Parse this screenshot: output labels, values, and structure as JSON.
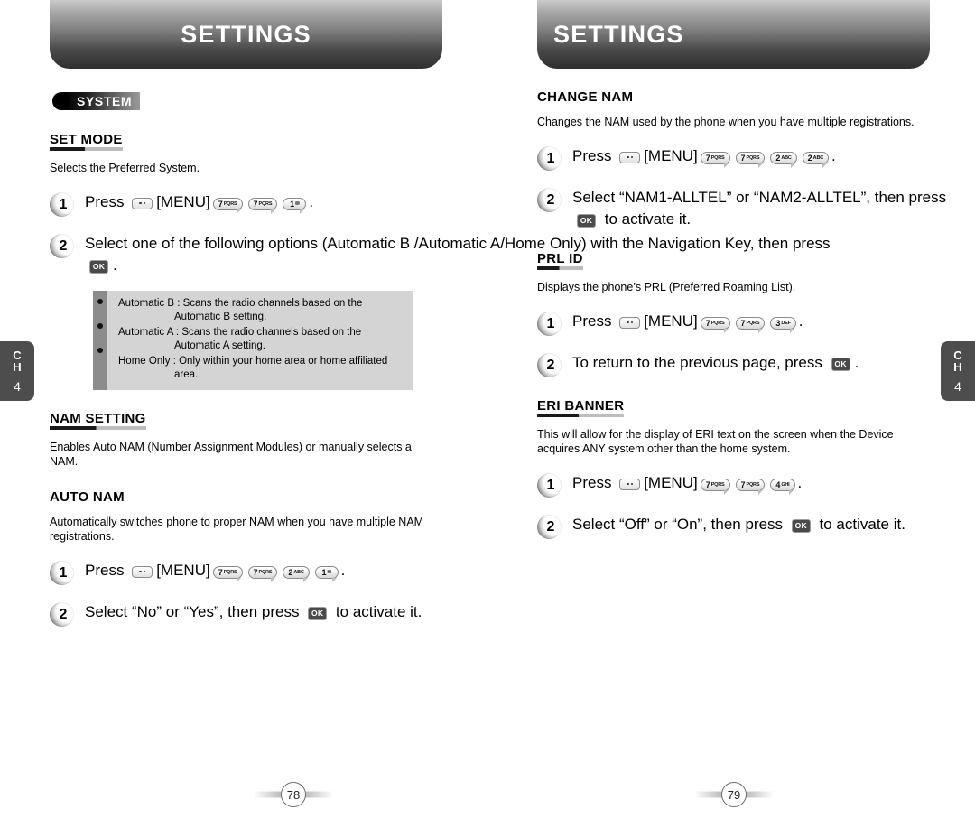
{
  "chapter_tab": {
    "line1": "C",
    "line2": "H",
    "number": "4"
  },
  "left_page": {
    "banner_title": "SETTINGS",
    "badge": {
      "label": "SYSTEM"
    },
    "sections": [
      {
        "heading": "SET MODE",
        "underlined": true,
        "description": "Selects the Preferred System.",
        "steps": [
          {
            "num": "1",
            "parts": [
              {
                "t": "text",
                "v": "Press "
              },
              {
                "t": "menu-key"
              },
              {
                "t": "text",
                "v": "[MENU]"
              },
              {
                "t": "key",
                "digit": "7",
                "letters": "PQRS"
              },
              {
                "t": "key",
                "digit": "7",
                "letters": "PQRS"
              },
              {
                "t": "key",
                "digit": "1",
                "letters": "✉"
              },
              {
                "t": "text",
                "v": "."
              }
            ]
          },
          {
            "num": "2",
            "parts": [
              {
                "t": "text",
                "v": "Select one of the following options (Automatic B /Automatic A/Home Only) with the Navigation Key, then press "
              },
              {
                "t": "ok"
              },
              {
                "t": "text",
                "v": "."
              }
            ]
          }
        ],
        "infobox": [
          {
            "label": "Automatic B : Scans the radio channels based on the",
            "cont": "Automatic B setting."
          },
          {
            "label": "Automatic A : Scans the radio channels based on the",
            "cont": "Automatic A setting."
          },
          {
            "label": "Home Only : Only within your home area or home affiliated",
            "cont": "area."
          }
        ]
      },
      {
        "heading": "NAM SETTING",
        "underlined": true,
        "description": "Enables Auto NAM (Number Assignment Modules) or manually selects a NAM.",
        "steps": []
      },
      {
        "heading": "AUTO NAM",
        "underlined": false,
        "description": "Automatically switches phone to proper NAM when you have multiple NAM registrations.",
        "steps": [
          {
            "num": "1",
            "parts": [
              {
                "t": "text",
                "v": "Press "
              },
              {
                "t": "menu-key"
              },
              {
                "t": "text",
                "v": "[MENU]"
              },
              {
                "t": "key",
                "digit": "7",
                "letters": "PQRS"
              },
              {
                "t": "key",
                "digit": "7",
                "letters": "PQRS"
              },
              {
                "t": "key",
                "digit": "2",
                "letters": "ABC"
              },
              {
                "t": "key",
                "digit": "1",
                "letters": "✉"
              },
              {
                "t": "text",
                "v": "."
              }
            ]
          },
          {
            "num": "2",
            "parts": [
              {
                "t": "text",
                "v": "Select “No” or “Yes”, then press "
              },
              {
                "t": "ok"
              },
              {
                "t": "text",
                "v": " to activate it."
              }
            ]
          }
        ]
      }
    ],
    "page_number": "78"
  },
  "right_page": {
    "banner_title": "SETTINGS",
    "sections": [
      {
        "heading": "CHANGE NAM",
        "underlined": false,
        "description": "Changes the NAM used by the phone when you have multiple registrations.",
        "steps": [
          {
            "num": "1",
            "parts": [
              {
                "t": "text",
                "v": "Press "
              },
              {
                "t": "menu-key"
              },
              {
                "t": "text",
                "v": "[MENU]"
              },
              {
                "t": "key",
                "digit": "7",
                "letters": "PQRS"
              },
              {
                "t": "key",
                "digit": "7",
                "letters": "PQRS"
              },
              {
                "t": "key",
                "digit": "2",
                "letters": "ABC"
              },
              {
                "t": "key",
                "digit": "2",
                "letters": "ABC"
              },
              {
                "t": "text",
                "v": "."
              }
            ]
          },
          {
            "num": "2",
            "parts": [
              {
                "t": "text",
                "v": "Select “NAM1-ALLTEL” or “NAM2-ALLTEL”, then press "
              },
              {
                "t": "ok"
              },
              {
                "t": "text",
                "v": " to activate it."
              }
            ]
          }
        ]
      },
      {
        "heading": "PRL ID",
        "underlined": true,
        "description": "Displays the phone’s PRL (Preferred Roaming List).",
        "steps": [
          {
            "num": "1",
            "parts": [
              {
                "t": "text",
                "v": "Press "
              },
              {
                "t": "menu-key"
              },
              {
                "t": "text",
                "v": "[MENU]"
              },
              {
                "t": "key",
                "digit": "7",
                "letters": "PQRS"
              },
              {
                "t": "key",
                "digit": "7",
                "letters": "PQRS"
              },
              {
                "t": "key",
                "digit": "3",
                "letters": "DEF"
              },
              {
                "t": "text",
                "v": "."
              }
            ]
          },
          {
            "num": "2",
            "parts": [
              {
                "t": "text",
                "v": "To return to the previous page, press "
              },
              {
                "t": "ok"
              },
              {
                "t": "text",
                "v": "."
              }
            ]
          }
        ]
      },
      {
        "heading": "ERI BANNER",
        "underlined": true,
        "description": "This will allow for the display of ERI text on the screen when the Device acquires ANY system other than the home system.",
        "steps": [
          {
            "num": "1",
            "parts": [
              {
                "t": "text",
                "v": "Press "
              },
              {
                "t": "menu-key"
              },
              {
                "t": "text",
                "v": "[MENU]"
              },
              {
                "t": "key",
                "digit": "7",
                "letters": "PQRS"
              },
              {
                "t": "key",
                "digit": "7",
                "letters": "PQRS"
              },
              {
                "t": "key",
                "digit": "4",
                "letters": "GHI"
              },
              {
                "t": "text",
                "v": "."
              }
            ]
          },
          {
            "num": "2",
            "parts": [
              {
                "t": "text",
                "v": "Select “Off” or “On”, then press "
              },
              {
                "t": "ok"
              },
              {
                "t": "text",
                "v": " to activate it."
              }
            ]
          }
        ]
      }
    ],
    "page_number": "79"
  }
}
